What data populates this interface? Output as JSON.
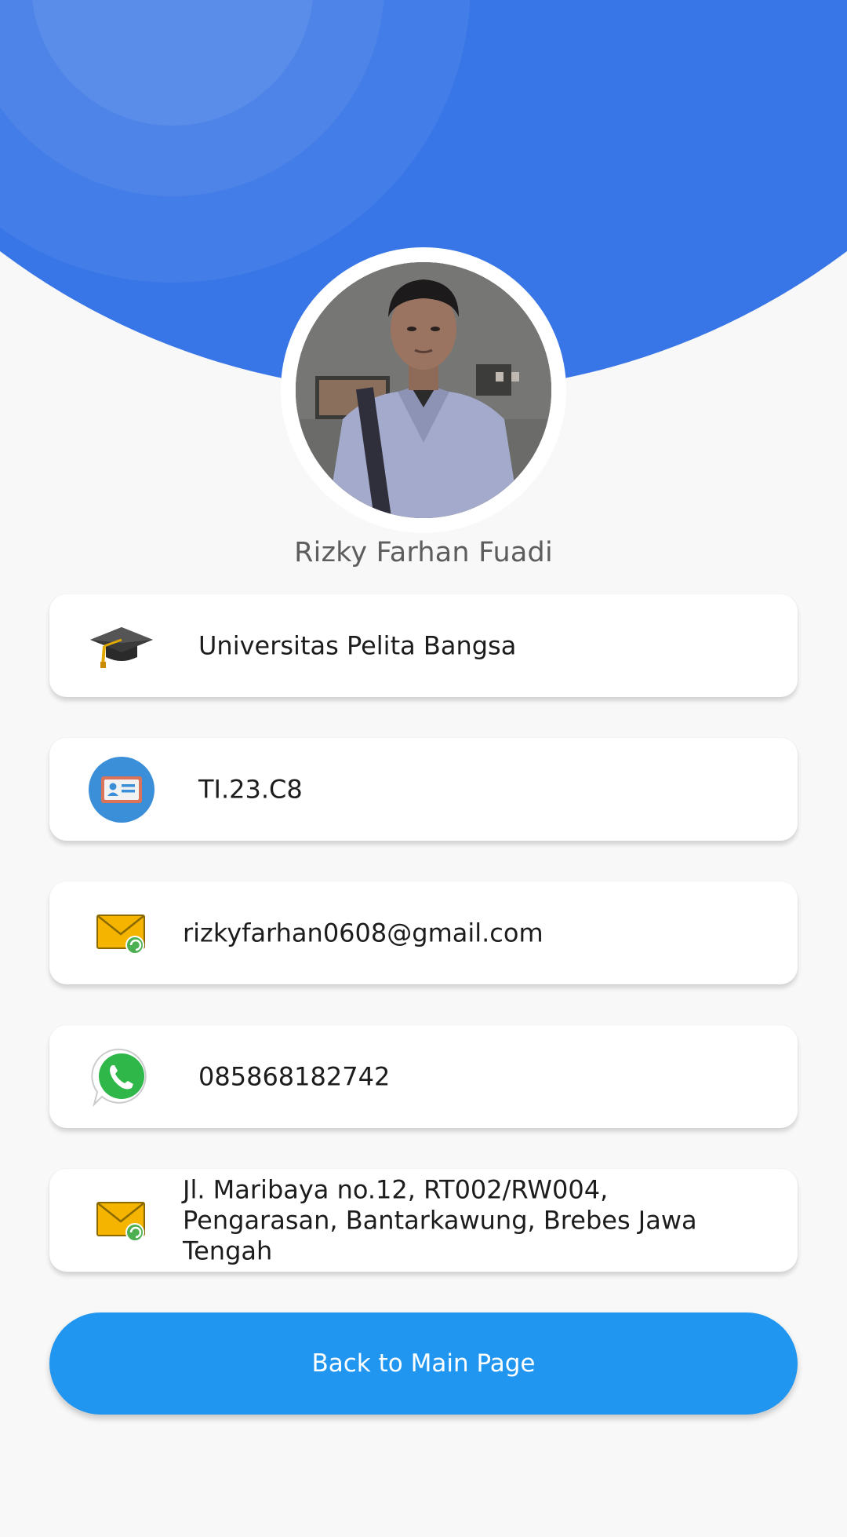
{
  "profile": {
    "name": "Rizky Farhan Fuadi"
  },
  "info_items": [
    {
      "icon": "graduation-cap-icon",
      "text": "Universitas Pelita Bangsa"
    },
    {
      "icon": "id-card-icon",
      "text": "TI.23.C8"
    },
    {
      "icon": "mail-icon",
      "text": "rizkyfarhan0608@gmail.com"
    },
    {
      "icon": "whatsapp-icon",
      "text": "085868182742"
    },
    {
      "icon": "mail-icon",
      "text": "Jl. Maribaya no.12, RT002/RW004, Pengarasan, Bantarkawung, Brebes Jawa Tengah"
    }
  ],
  "actions": {
    "back_label": "Back to Main Page"
  },
  "colors": {
    "header": "#3875e6",
    "button": "#2196f0",
    "background": "#f8f8f8"
  }
}
